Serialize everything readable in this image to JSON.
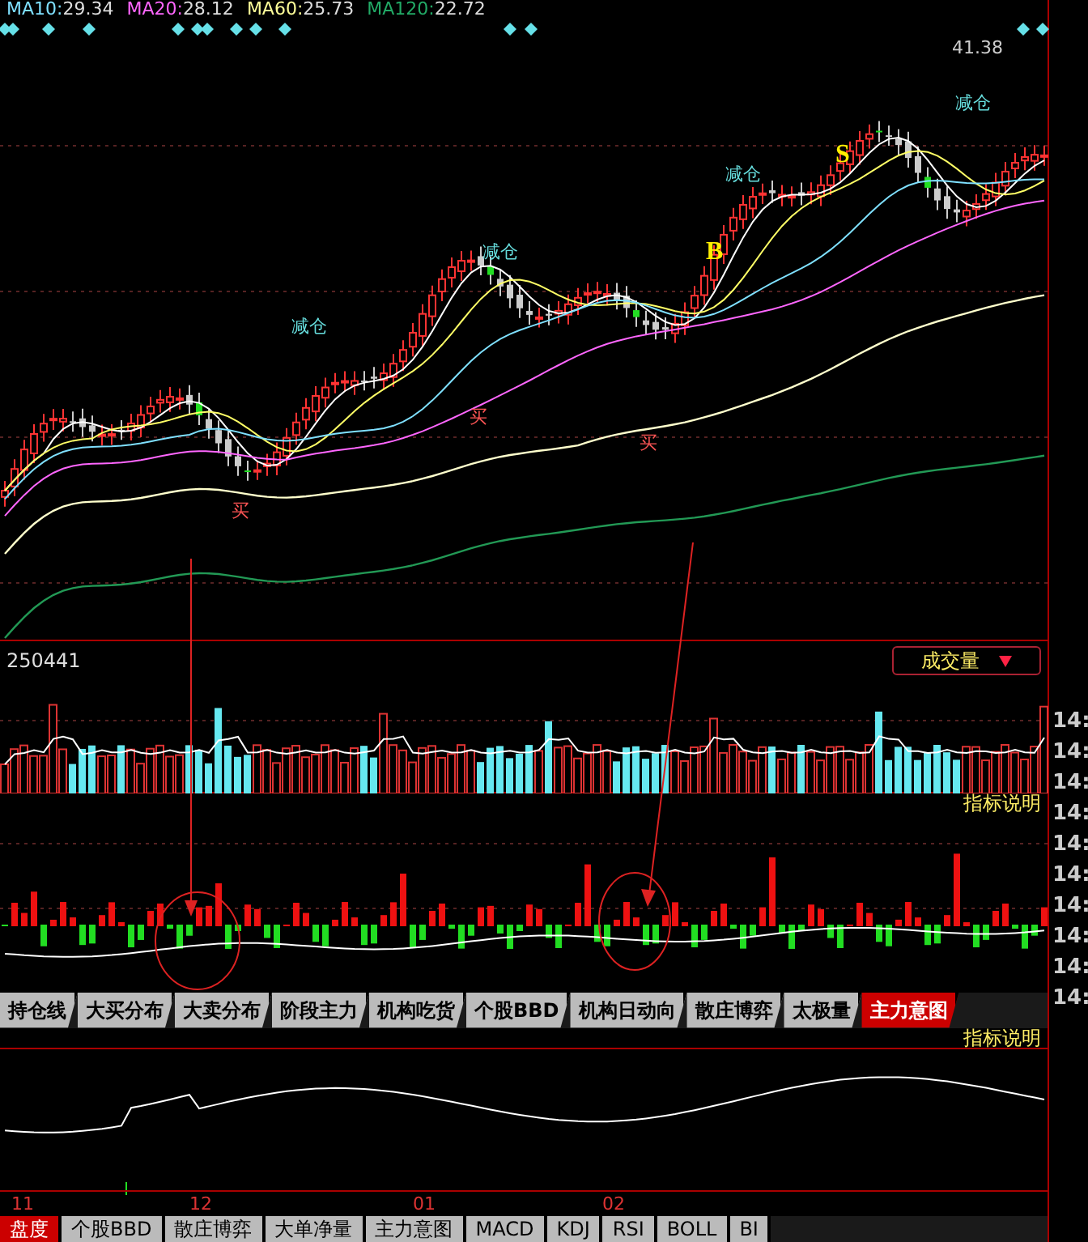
{
  "ma_legend": [
    {
      "label": "MA10:",
      "value": "29.34",
      "color": "#7fe0ff"
    },
    {
      "label": "MA20:",
      "value": "28.12",
      "color": "#ff66ff"
    },
    {
      "label": "MA60:",
      "value": "25.73",
      "color": "#ffff99"
    },
    {
      "label": "MA120:",
      "value": "22.72",
      "color": "#22aa66"
    }
  ],
  "price_label": "41.38",
  "signals": [
    {
      "kind": "reduce",
      "text": "减仓"
    },
    {
      "kind": "reduce",
      "text": "减仓"
    },
    {
      "kind": "reduce",
      "text": "减仓"
    },
    {
      "kind": "reduce",
      "text": "减仓"
    },
    {
      "kind": "buy",
      "text": "买"
    },
    {
      "kind": "buy",
      "text": "买"
    },
    {
      "kind": "buy",
      "text": "买"
    },
    {
      "kind": "b",
      "text": "B"
    },
    {
      "kind": "s",
      "text": "S"
    }
  ],
  "volume_panel": {
    "value": "250441",
    "indicator_select": "成交量",
    "help_link": "指标说明"
  },
  "indicator_tabs": [
    {
      "label": "持仓线",
      "selected": false
    },
    {
      "label": "大买分布",
      "selected": false
    },
    {
      "label": "大卖分布",
      "selected": false
    },
    {
      "label": "阶段主力",
      "selected": false
    },
    {
      "label": "机构吃货",
      "selected": false
    },
    {
      "label": "个股BBD",
      "selected": false
    },
    {
      "label": "机构日动向",
      "selected": false
    },
    {
      "label": "散庄博弈",
      "selected": false
    },
    {
      "label": "太极量",
      "selected": false
    },
    {
      "label": "主力意图",
      "selected": true
    }
  ],
  "indicator_help": "指标说明",
  "right_axis_labels": [
    "14:",
    "14:",
    "14:",
    "14:",
    "14:",
    "14:",
    "14:",
    "14:",
    "14:",
    "14:"
  ],
  "x_axis": [
    "11",
    "12",
    "01",
    "02"
  ],
  "bottom_tabs": [
    {
      "label": "盘度",
      "selected": true
    },
    {
      "label": "个股BBD",
      "selected": false
    },
    {
      "label": "散庄博弈",
      "selected": false
    },
    {
      "label": "大单净量",
      "selected": false
    },
    {
      "label": "主力意图",
      "selected": false
    },
    {
      "label": "MACD",
      "selected": false
    },
    {
      "label": "KDJ",
      "selected": false
    },
    {
      "label": "RSI",
      "selected": false
    },
    {
      "label": "BOLL",
      "selected": false
    },
    {
      "label": "BI",
      "selected": false
    }
  ]
}
